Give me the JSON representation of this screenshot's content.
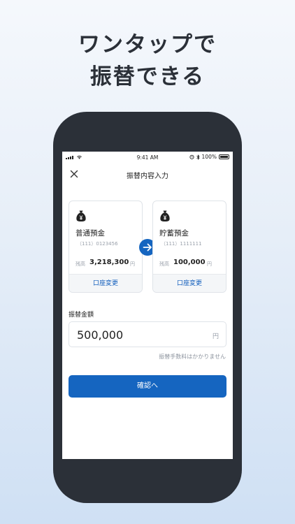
{
  "headline": {
    "line1": "ワンタップで",
    "line2": "振替できる"
  },
  "statusbar": {
    "time": "9:41 AM",
    "battery_pct": "100%"
  },
  "navbar": {
    "title": "振替内容入力"
  },
  "from_account": {
    "name": "普通預金",
    "number": "（111）0123456",
    "balance_label": "残高",
    "balance": "3,218,300",
    "yen": "円",
    "action": "口座変更"
  },
  "to_account": {
    "name": "貯蓄預金",
    "number": "（111）1111111",
    "balance_label": "残高",
    "balance": "100,000",
    "yen": "円",
    "action": "口座変更"
  },
  "amount": {
    "label": "振替金額",
    "value": "500,000",
    "unit": "円"
  },
  "fee_note": "振替手数料はかかりません",
  "confirm_label": "確認へ",
  "icons": {
    "close": "close-icon",
    "money_bag": "money-bag-icon",
    "arrow": "arrow-right-icon"
  },
  "colors": {
    "accent": "#1565c0",
    "phone_body": "#2b3038",
    "link": "#1560bd"
  }
}
